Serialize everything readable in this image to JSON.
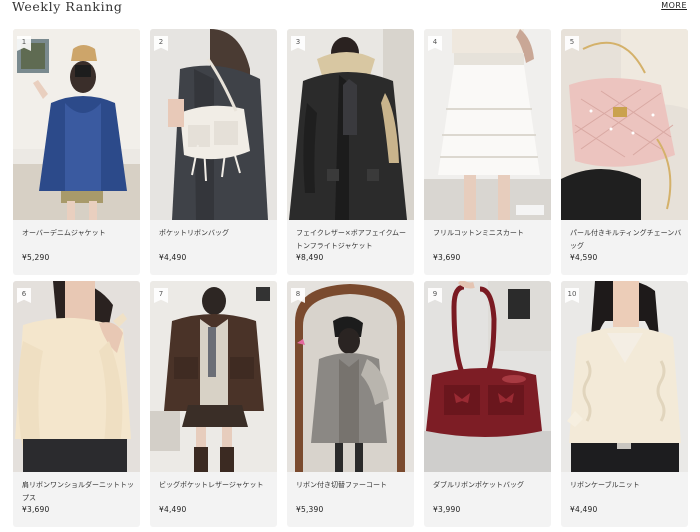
{
  "header": {
    "title": "Weekly Ranking",
    "more_label": "MORE"
  },
  "products": [
    {
      "rank": "1",
      "name": "オーバーデニムジャケット",
      "price": "¥5,290",
      "image": "denim-jacket-photo"
    },
    {
      "rank": "2",
      "name": "ポケットリボンバッグ",
      "price": "¥4,490",
      "image": "white-ribbon-bag-photo"
    },
    {
      "rank": "3",
      "name": "フェイクレザー×ボアフェイクムートンフライトジャケット",
      "price": "¥8,490",
      "image": "leather-flight-jacket-photo"
    },
    {
      "rank": "4",
      "name": "フリルコットンミニスカート",
      "price": "¥3,690",
      "image": "white-frill-skirt-photo"
    },
    {
      "rank": "5",
      "name": "パール付きキルティングチェーンバッグ",
      "price": "¥4,590",
      "image": "pink-quilted-bag-photo"
    },
    {
      "rank": "6",
      "name": "肩リボンワンショルダーニットトップス",
      "price": "¥3,690",
      "image": "cream-knit-top-photo"
    },
    {
      "rank": "7",
      "name": "ビッグポケットレザージャケット",
      "price": "¥4,490",
      "image": "brown-leather-jacket-photo"
    },
    {
      "rank": "8",
      "name": "リボン付き切替ファーコート",
      "price": "¥5,390",
      "image": "grey-fur-coat-photo"
    },
    {
      "rank": "9",
      "name": "ダブルリボンポケットバッグ",
      "price": "¥3,990",
      "image": "red-ribbon-bag-photo"
    },
    {
      "rank": "10",
      "name": "リボンケーブルニット",
      "price": "¥4,490",
      "image": "cream-cable-knit-photo"
    }
  ]
}
